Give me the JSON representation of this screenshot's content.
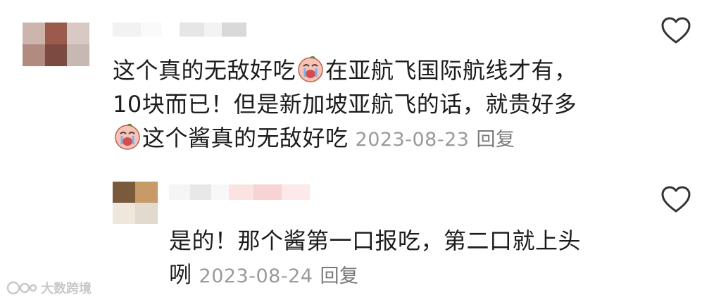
{
  "comments": [
    {
      "lines": [
        {
          "before": "这个真的无敌好吃",
          "emoji": "crying-face-emoji",
          "after": "在亚航飞国际航线才有，"
        },
        {
          "text": "10块而已！但是新加坡亚航飞的话，就贵好多"
        },
        {
          "emoji": "crying-face-emoji",
          "text": "这个酱真的无敌好吃"
        }
      ],
      "date": "2023-08-23",
      "reply_label": "回复",
      "like_icon": "heart-icon"
    },
    {
      "lines": [
        {
          "text": "是的！那个酱第一口报吃，第二口就上头"
        },
        {
          "text": "咧"
        }
      ],
      "date": "2023-08-24",
      "reply_label": "回复",
      "like_icon": "heart-icon"
    }
  ],
  "watermark": {
    "text": "大数跨境",
    "icon": "logo-icon"
  },
  "colors": {
    "text": "#1c1c1c",
    "meta": "#9a9a9a",
    "heart": "#333333",
    "watermark": "#c8c8c8"
  }
}
